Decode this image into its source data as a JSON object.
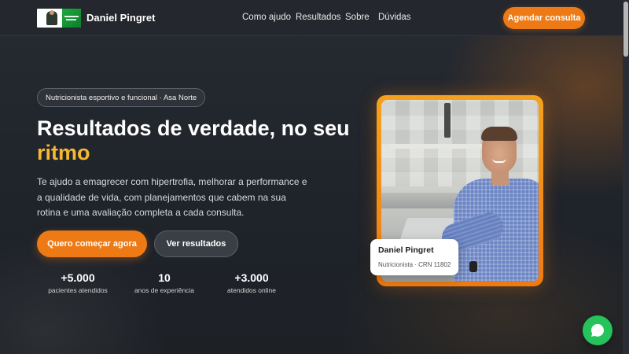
{
  "header": {
    "brand_name": "Daniel Pingret",
    "nav": [
      "Como ajudo",
      "Resultados",
      "Sobre",
      "Dúvidas"
    ],
    "cta_label": "Agendar consulta"
  },
  "hero": {
    "pill": "Nutricionista esportivo e funcional · Asa Norte",
    "headline_main": "Resultados de verdade, no seu ",
    "headline_accent": "ritmo",
    "description": "Te ajudo a emagrecer com hipertrofia, melhorar a performance e a qualidade de vida, com planejamentos que cabem na sua rotina e uma avaliação completa a cada consulta.",
    "primary_button": "Quero começar agora",
    "secondary_button": "Ver resultados",
    "stats": [
      {
        "value": "+5.000",
        "label": "pacientes atendidos"
      },
      {
        "value": "10",
        "label": "anos de experiência"
      },
      {
        "value": "+3.000",
        "label": "atendidos online"
      }
    ]
  },
  "profile_card": {
    "name": "Daniel Pingret",
    "role": "Nutricionista · CRN 11802"
  },
  "colors": {
    "accent": "#ee7a16",
    "highlight": "#f7b733",
    "whatsapp": "#25c35b"
  },
  "icons": {
    "floating": "whatsapp-icon"
  }
}
